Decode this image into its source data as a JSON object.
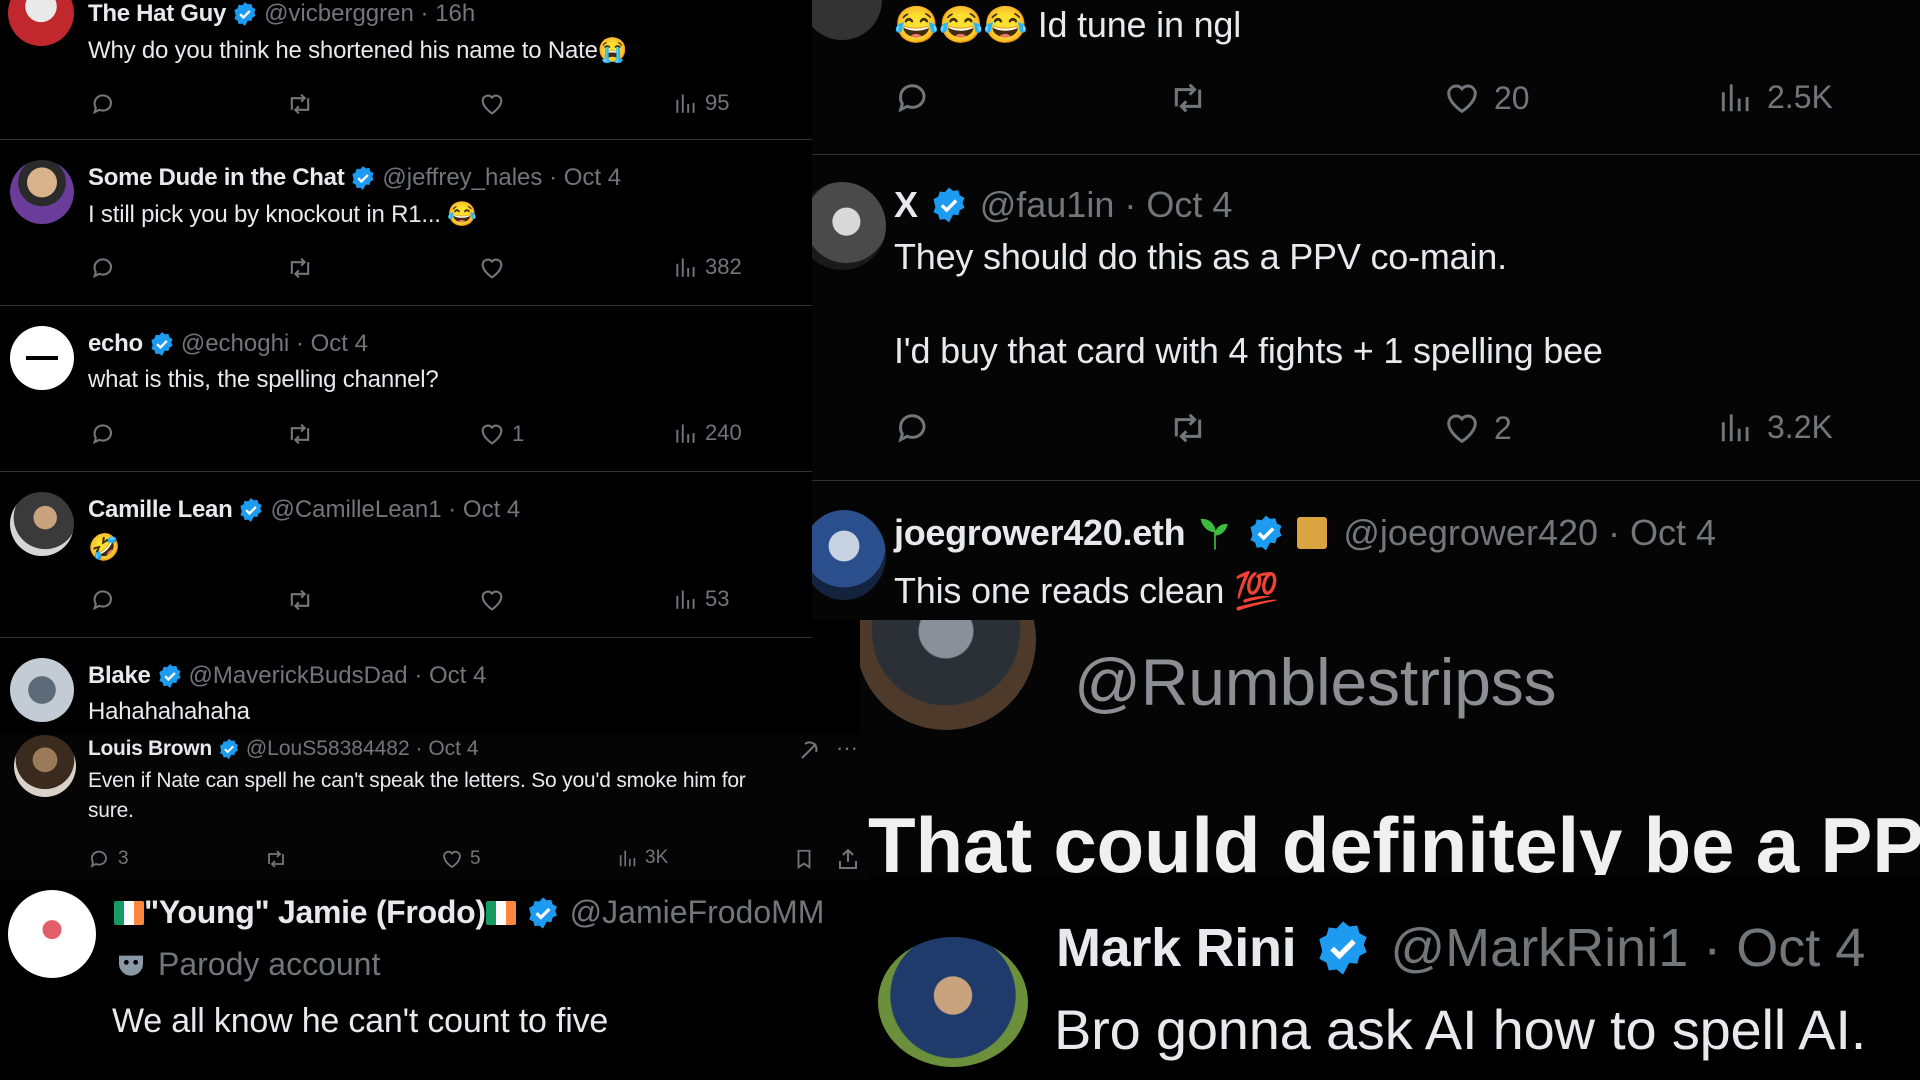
{
  "left_column": {
    "tweets": [
      {
        "name": "The Hat Guy",
        "handle": "@vicberggren",
        "time": "16h",
        "text": "Why do you think he shortened his name to Nate",
        "emoji": "😭",
        "views": "95"
      },
      {
        "name": "Some Dude in the Chat",
        "handle": "@jeffrey_hales",
        "time": "Oct 4",
        "text": "I still pick you by knockout in R1...",
        "emoji": "😂",
        "views": "382"
      },
      {
        "name": "echo",
        "handle": "@echoghi",
        "time": "Oct 4",
        "text": "what is this, the spelling channel?",
        "likes": "1",
        "views": "240"
      },
      {
        "name": "Camille Lean",
        "handle": "@CamilleLean1",
        "time": "Oct 4",
        "text": "",
        "emoji": "🤣",
        "views": "53"
      },
      {
        "name": "Blake",
        "handle": "@MaverickBudsDad",
        "time": "Oct 4",
        "text": "Hahahahahaha"
      }
    ],
    "louis": {
      "name": "Louis Brown",
      "handle": "@LouS58384482",
      "time": "Oct 4",
      "line1": "Even if Nate can spell he can't speak the letters. So you'd smoke him for",
      "line2": "sure.",
      "replies": "3",
      "likes": "5",
      "views": "3K",
      "more": "···"
    },
    "jamie": {
      "name": "\"Young\" Jamie (Frodo)",
      "handle": "@JamieFrodoMM",
      "parody": "Parody account",
      "text": "We all know he can't count to five"
    }
  },
  "right_column": {
    "top": {
      "text": "Id tune in ngl",
      "emoji": "😂😂😂",
      "likes": "20",
      "views": "2.5K"
    },
    "x_tweet": {
      "name": "X",
      "handle": "@fau1in",
      "time": "Oct 4",
      "line1": "They should do this as a PPV co-main.",
      "line2": "I'd buy that card with 4 fights + 1 spelling bee",
      "likes": "2",
      "views": "3.2K"
    },
    "joe": {
      "name": "joegrower420.eth",
      "handle": "@joegrower420",
      "time": "Oct 4",
      "text": "This one reads clean",
      "emoji": "💯"
    },
    "rumble": {
      "handle": "@Rumblestripss",
      "text": "That could definitely be a PPV."
    },
    "mark": {
      "name": "Mark Rini",
      "handle": "@MarkRini1",
      "time": "Oct 4",
      "text": "Bro gonna ask AI how to spell AI."
    }
  },
  "colors": {
    "verified": "#1d9bf0",
    "muted": "#71767b",
    "text": "#e7e9ea",
    "divider": "#2f3336"
  }
}
